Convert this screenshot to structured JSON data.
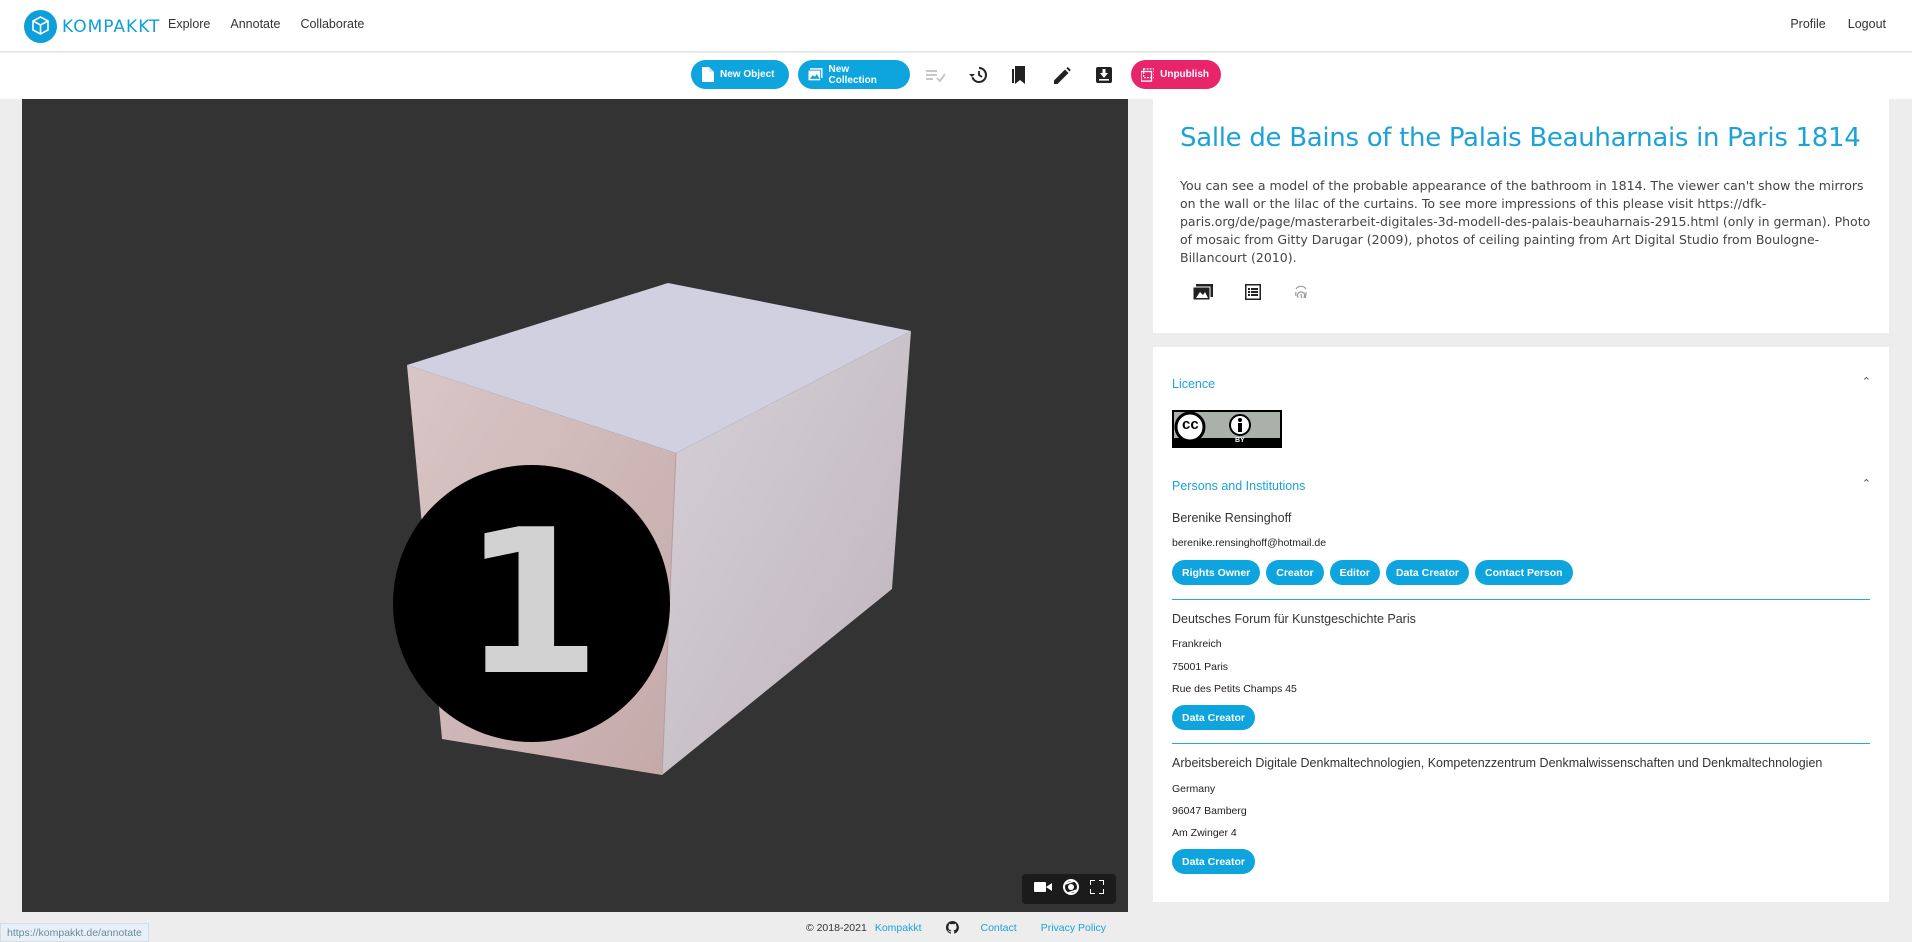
{
  "app": {
    "brand": "KOMPAKKT"
  },
  "nav": {
    "links": [
      "Explore",
      "Annotate",
      "Collaborate"
    ],
    "right": [
      "Profile",
      "Logout"
    ]
  },
  "toolbar": {
    "new_object": "New Object",
    "new_collection": "New Collection",
    "unpublish": "Unpublish"
  },
  "viewer": {
    "overlay_number": "1"
  },
  "object": {
    "title": "Salle de Bains of the Palais Beauharnais in Paris 1814",
    "description": "You can see a model of the probable appearance of the bathroom in 1814. The viewer can't show the mirrors on the wall or the lilac of the curtains. To see more impressions of this please visit https://dfk-paris.org/de/page/masterarbeit-digitales-3d-modell-des-palais-beauharnais-2915.html (only in german). Photo of mosaic from Gitty Darugar (2009), photos of ceiling painting from Art Digital Studio from Boulogne-Billancourt (2010)."
  },
  "licence": {
    "heading": "Licence",
    "badge_left": "cc",
    "badge_right": "BY"
  },
  "persons": {
    "heading": "Persons and Institutions",
    "person1": {
      "name": "Berenike Rensinghoff",
      "email": "berenike.rensinghoff@hotmail.de",
      "roles": [
        "Rights Owner",
        "Creator",
        "Editor",
        "Data Creator",
        "Contact Person"
      ]
    },
    "inst1": {
      "name": "Deutsches Forum für Kunstgeschichte Paris",
      "country": "Frankreich",
      "city": "75001  Paris",
      "street": "Rue des Petits Champs  45",
      "roles": [
        "Data Creator"
      ]
    },
    "inst2": {
      "name": "Arbeitsbereich Digitale Denkmaltechnologien, Kompetenzzentrum Denkmalwissenschaften und Denkmaltechnologien",
      "country": "Germany",
      "city": "96047  Bamberg",
      "street": "Am Zwinger  4",
      "roles": [
        "Data Creator"
      ]
    }
  },
  "footer": {
    "copyright": "© 2018-2021",
    "brand_link": "Kompakkt",
    "contact": "Contact",
    "privacy": "Privacy Policy"
  },
  "status_url": "https://kompakkt.de/annotate",
  "colors": {
    "accent": "#0ea5de",
    "unpublish": "#e8246a",
    "viewer_bg": "#333333"
  }
}
